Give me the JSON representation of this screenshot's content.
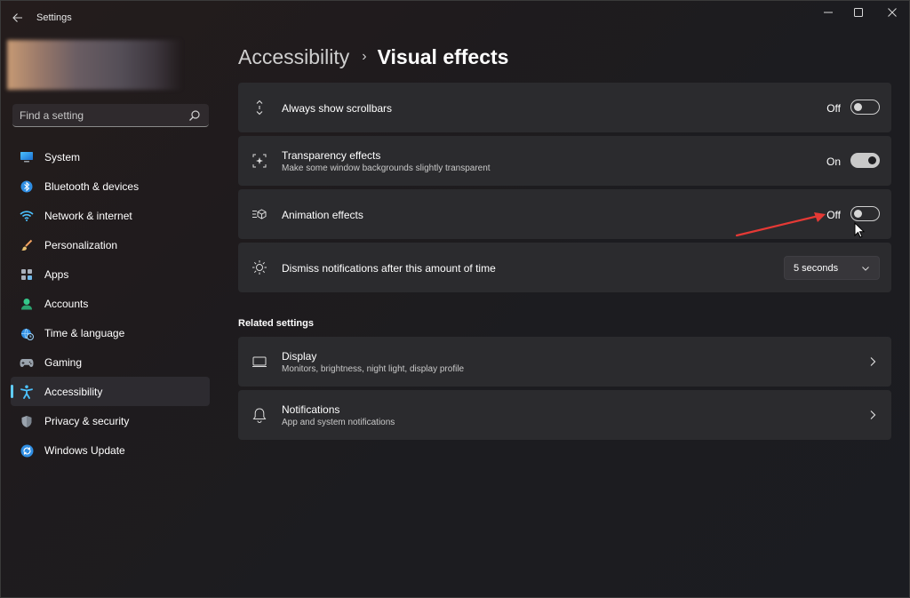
{
  "window": {
    "title": "Settings"
  },
  "search": {
    "placeholder": "Find a setting"
  },
  "sidebar": {
    "items": [
      {
        "label": "System",
        "icon": "system-icon",
        "active": false
      },
      {
        "label": "Bluetooth & devices",
        "icon": "bluetooth-icon",
        "active": false
      },
      {
        "label": "Network & internet",
        "icon": "wifi-icon",
        "active": false
      },
      {
        "label": "Personalization",
        "icon": "brush-icon",
        "active": false
      },
      {
        "label": "Apps",
        "icon": "apps-icon",
        "active": false
      },
      {
        "label": "Accounts",
        "icon": "account-icon",
        "active": false
      },
      {
        "label": "Time & language",
        "icon": "globe-clock-icon",
        "active": false
      },
      {
        "label": "Gaming",
        "icon": "gamepad-icon",
        "active": false
      },
      {
        "label": "Accessibility",
        "icon": "accessibility-icon",
        "active": true
      },
      {
        "label": "Privacy & security",
        "icon": "shield-icon",
        "active": false
      },
      {
        "label": "Windows Update",
        "icon": "update-icon",
        "active": false
      }
    ]
  },
  "breadcrumb": {
    "parent": "Accessibility",
    "separator": "›",
    "current": "Visual effects"
  },
  "settings": {
    "scrollbars": {
      "title": "Always show scrollbars",
      "state": "Off",
      "on": false
    },
    "transparency": {
      "title": "Transparency effects",
      "description": "Make some window backgrounds slightly transparent",
      "state": "On",
      "on": true
    },
    "animation": {
      "title": "Animation effects",
      "state": "Off",
      "on": false
    },
    "notifications_timeout": {
      "title": "Dismiss notifications after this amount of time",
      "value": "5 seconds"
    }
  },
  "related": {
    "header": "Related settings",
    "display": {
      "title": "Display",
      "description": "Monitors, brightness, night light, display profile"
    },
    "notifications": {
      "title": "Notifications",
      "description": "App and system notifications"
    }
  },
  "colors": {
    "accent": "#60cdff",
    "annotation_arrow": "#e53935",
    "card_bg": "#2b2b2e"
  }
}
